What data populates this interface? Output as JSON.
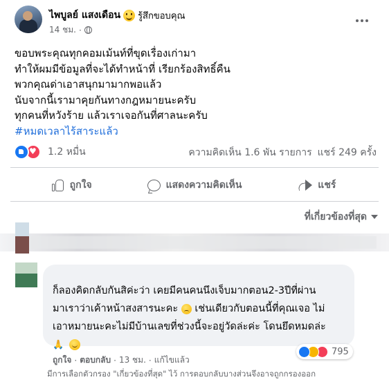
{
  "post": {
    "author": "ไพบูลย์ แสงเดือน",
    "feeling": "รู้สึกขอบคุณ",
    "time": "14 ชม.",
    "lines": [
      "ขอบพระคุณทุกคอมเม้นท์ที่ขุดเรื่องเก่ามา",
      "ทำให้ผมมีข้อมูลที่จะได้ทำหน้าที่ เรียกร้องสิทธิ์คืน",
      "พวกคุณด่าเอาสนุกมามากพอแล้ว",
      "นับจากนี้เรามาคุยกันทางกฎหมายนะครับ",
      "ทุกคนที่หวังร้าย แล้วเราเจอกันที่ศาลนะครับ"
    ],
    "hashtag": "#หมดเวลาไร้สาระแล้ว",
    "reaction_count": "1.2 หมื่น",
    "comments_stat": "ความคิดเห็น 1.6 พัน รายการ",
    "shares_stat": "แชร์ 249 ครั้ง"
  },
  "actions": {
    "like": "ถูกใจ",
    "comment": "แสดงความคิดเห็น",
    "share": "แชร์"
  },
  "sort_label": "ที่เกี่ยวข้องที่สุด",
  "comment": {
    "lines": [
      "ก็ลองคิดกลับกันสิค่ะว่า เคยมีคนคนนึงเจ็บมากตอน2-3ปีที่ผ่าน",
      "มาเราว่าเค้าหน้าสงสารนะคะ",
      "เช่นเดียวกับตอนนี้ที่คุณเจอ ไม่",
      "เอาหมายนะคะไม่มีบ้านเลขที่ช่วงนี้จะอยู่วัดล่ะค่ะ โดนยึดหมดล่ะ"
    ],
    "like": "ถูกใจ",
    "reply": "ตอบกลับ",
    "time": "13 ชม.",
    "edited": "แก้ไขแล้ว",
    "reaction_count": "795"
  },
  "footnote": "มีการเลือกตัวกรอง \"เกี่ยวข้องที่สุด\" ไว้ การตอบกลับบางส่วนจึงอาจถูกกรองออก",
  "icons": [
    "globe-icon",
    "more-icon",
    "like-icon",
    "comment-icon",
    "share-icon",
    "caret-down-icon"
  ]
}
